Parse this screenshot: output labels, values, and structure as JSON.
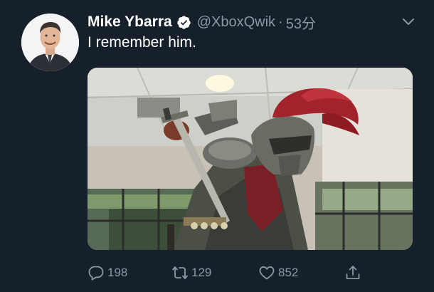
{
  "author": {
    "display_name": "Mike Ybarra",
    "handle": "@XboxQwik",
    "separator": "·",
    "time_ago": "53分",
    "verified": true,
    "avatar_icon": "profile-photo"
  },
  "tweet": {
    "text": "I remember him.",
    "media_description_icon": "photo-roman-soldier-statue"
  },
  "actions": {
    "reply_count": "198",
    "retweet_count": "129",
    "like_count": "852",
    "reply_icon": "reply-icon",
    "retweet_icon": "retweet-icon",
    "like_icon": "heart-icon",
    "share_icon": "share-icon"
  },
  "colors": {
    "background": "#15202b",
    "secondary_text": "#8899a6",
    "primary_text": "#ffffff"
  }
}
